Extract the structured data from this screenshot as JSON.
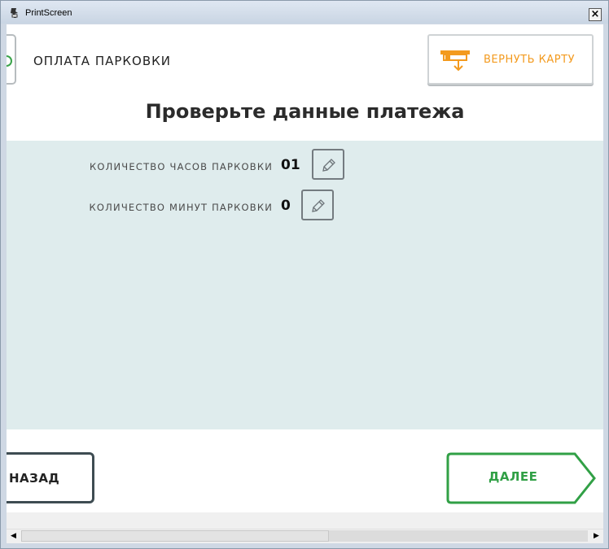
{
  "window": {
    "title": "PrintScreen",
    "close_label": "×"
  },
  "header": {
    "section_title": "ОПЛАТА ПАРКОВКИ",
    "return_card_label": "ВЕРНУТЬ КАРТУ"
  },
  "main": {
    "heading": "Проверьте данные платежа",
    "rows": [
      {
        "label": "КОЛИЧЕСТВО ЧАСОВ ПАРКОВКИ",
        "value": "01"
      },
      {
        "label": "КОЛИЧЕСТВО МИНУТ ПАРКОВКИ",
        "value": "0"
      }
    ]
  },
  "footer": {
    "back_label": "НАЗАД",
    "next_label": "ДАЛЕЕ"
  },
  "colors": {
    "accent_orange": "#f39a1e",
    "accent_green": "#31a046",
    "panel_bg": "#dfeced",
    "back_border": "#3e4c52"
  },
  "icons": [
    "printscreen-app-icon",
    "return-card-icon",
    "pencil-icon"
  ]
}
